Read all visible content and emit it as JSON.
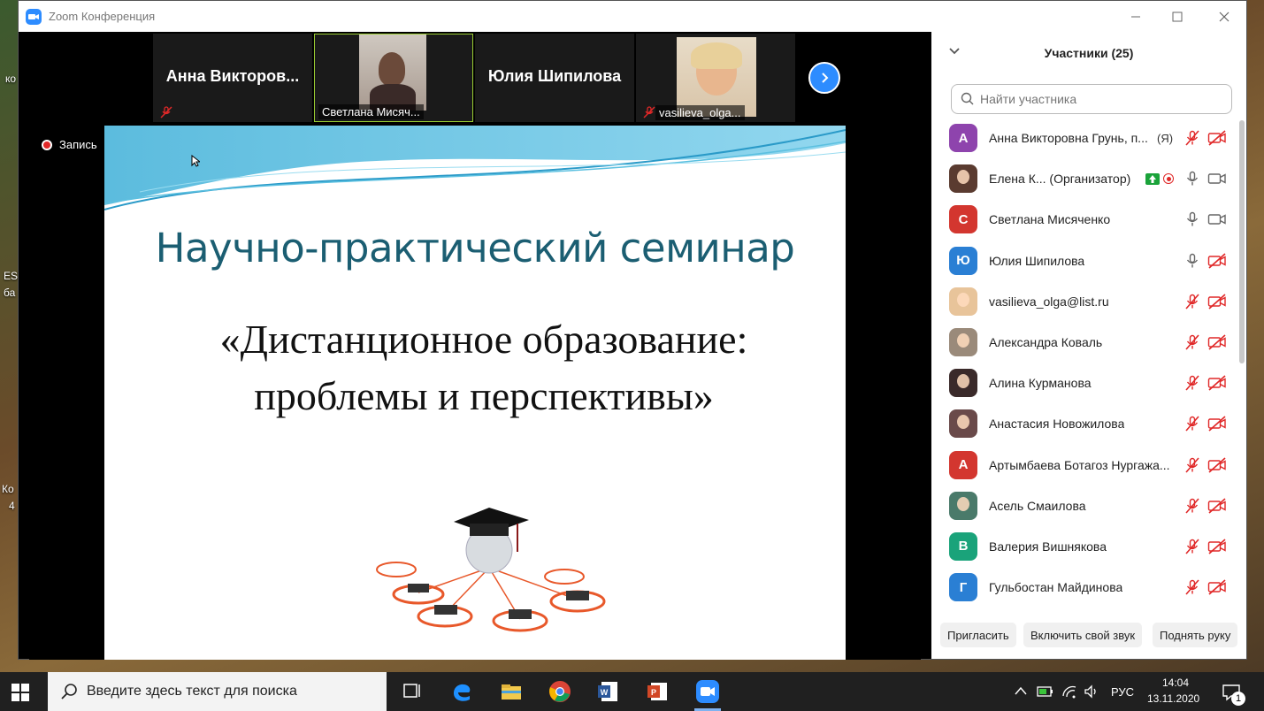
{
  "window": {
    "title": "Zoom Конференция"
  },
  "desktop": {
    "frag1": "ко",
    "frag2": "ES",
    "frag3": "ба",
    "frag4": "Ко",
    "frag5": "4"
  },
  "video_strip": {
    "tiles": [
      {
        "name": "Анна  Викторов...",
        "muted": true
      },
      {
        "name": "Светлана Мисяч...",
        "muted": false
      },
      {
        "name": "Юлия Шипилова"
      },
      {
        "name": "vasilieva_olga...",
        "muted": true
      }
    ]
  },
  "share": {
    "recording_label": "Запись",
    "slide_title": "Научно-практический семинар",
    "slide_subtitle_line1": "«Дистанционное образование:",
    "slide_subtitle_line2": "проблемы и перспективы»"
  },
  "panel": {
    "title": "Участники (25)",
    "search_placeholder": "Найти участника",
    "participants": [
      {
        "name": "Анна Викторовна Грунь, п...",
        "initial": "А",
        "color": "#8e44ad",
        "suffix": "(Я)",
        "mic": "muted",
        "cam": "off"
      },
      {
        "name": "Елена К... (Организатор)",
        "initial": "",
        "color": "#5a3b30",
        "mic": "on",
        "cam": "on",
        "photo": true
      },
      {
        "name": "Светлана Мисяченко",
        "initial": "С",
        "color": "#d3362f",
        "mic": "on",
        "cam": "on"
      },
      {
        "name": "Юлия Шипилова",
        "initial": "Ю",
        "color": "#2a7fd4",
        "mic": "on",
        "cam": "off"
      },
      {
        "name": "vasilieva_olga@list.ru",
        "initial": "",
        "color": "#e8c49a",
        "mic": "muted",
        "cam": "off",
        "photo": true
      },
      {
        "name": "Александра Коваль",
        "initial": "",
        "color": "#9a8a7a",
        "mic": "muted",
        "cam": "off",
        "photo": true
      },
      {
        "name": "Алина Курманова",
        "initial": "",
        "color": "#3a2a2a",
        "mic": "muted",
        "cam": "off",
        "photo": true
      },
      {
        "name": "Анастасия Новожилова",
        "initial": "",
        "color": "#6a4a4a",
        "mic": "muted",
        "cam": "off",
        "photo": true
      },
      {
        "name": "Артымбаева Ботагоз Нургажа...",
        "initial": "А",
        "color": "#d3362f",
        "mic": "muted",
        "cam": "off"
      },
      {
        "name": "Асель Смаилова",
        "initial": "",
        "color": "#4a7a6a",
        "mic": "muted",
        "cam": "off",
        "photo": true
      },
      {
        "name": "Валерия Вишнякова",
        "initial": "В",
        "color": "#1aa37a",
        "mic": "muted",
        "cam": "off"
      },
      {
        "name": "Гульбостан Майдинова",
        "initial": "Г",
        "color": "#2a7fd4",
        "mic": "muted",
        "cam": "off"
      }
    ],
    "buttons": {
      "invite": "Пригласить",
      "unmute": "Включить свой звук",
      "raise_hand": "Поднять руку"
    }
  },
  "taskbar": {
    "search_text": "Введите здесь текст для поиска",
    "language": "РУС",
    "time": "14:04",
    "date": "13.11.2020",
    "notification_count": "1"
  }
}
